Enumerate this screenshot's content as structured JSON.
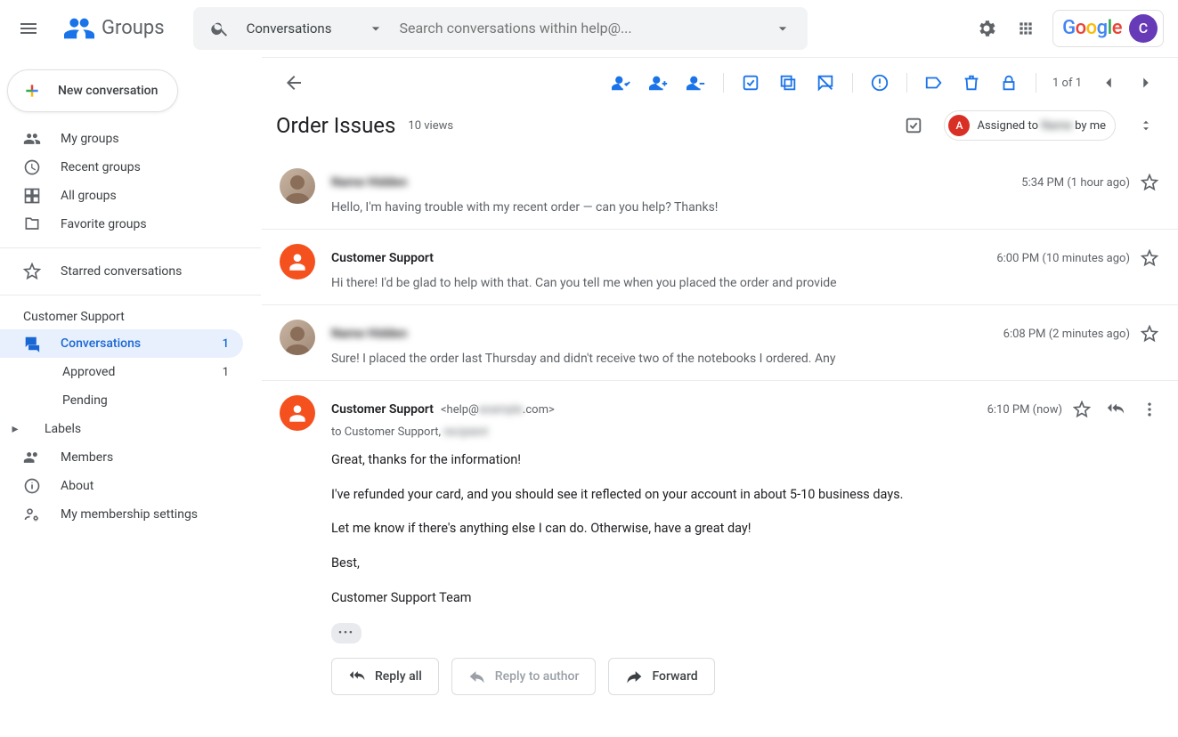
{
  "header": {
    "product": "Groups",
    "search_scope": "Conversations",
    "search_placeholder": "Search conversations within help@...",
    "account_initial": "C"
  },
  "sidebar": {
    "new_conversation": "New conversation",
    "nav1": [
      {
        "label": "My groups"
      },
      {
        "label": "Recent groups"
      },
      {
        "label": "All groups"
      },
      {
        "label": "Favorite groups"
      }
    ],
    "starred": "Starred conversations",
    "group_name": "Customer Support",
    "group_nav": {
      "conversations": {
        "label": "Conversations",
        "count": "1"
      },
      "approved": {
        "label": "Approved",
        "count": "1"
      },
      "pending": {
        "label": "Pending"
      }
    },
    "labels": "Labels",
    "members": "Members",
    "about": "About",
    "membership": "My membership settings"
  },
  "toolbar": {
    "page_indicator": "1 of 1"
  },
  "thread": {
    "title": "Order Issues",
    "views": "10 views",
    "assigned_prefix": "Assigned to ",
    "assigned_name_blur": "Name",
    "assigned_suffix": " by me",
    "assigned_initial": "A"
  },
  "messages": [
    {
      "sender_blur": "Name Hidden",
      "time": "5:34 PM (1 hour ago)",
      "snippet": "Hello, I'm having trouble with my recent order — can you help? Thanks!"
    },
    {
      "sender": "Customer Support",
      "time": "6:00 PM (10 minutes ago)",
      "snippet": "Hi there! I'd be glad to help with that. Can you tell me when you placed the order and provide"
    },
    {
      "sender_blur": "Name Hidden",
      "time": "6:08 PM (2 minutes ago)",
      "snippet": "Sure! I placed the order last Thursday and didn't receive two of the notebooks I ordered. Any"
    }
  ],
  "expanded": {
    "sender": "Customer Support",
    "email_prefix": "<help@",
    "email_blur": "example",
    "email_suffix": ".com>",
    "time": "6:10 PM (now)",
    "to_prefix": "to Customer Support, ",
    "to_blur": "recipient",
    "body": [
      "Great, thanks for the information!",
      "I've refunded your card, and you should see it reflected on your account in about 5-10 business days.",
      "Let me know if there's anything else I can do. Otherwise, have a great day!",
      "Best,",
      "Customer Support Team"
    ]
  },
  "reply": {
    "reply_all": "Reply all",
    "reply_author": "Reply to author",
    "forward": "Forward"
  }
}
